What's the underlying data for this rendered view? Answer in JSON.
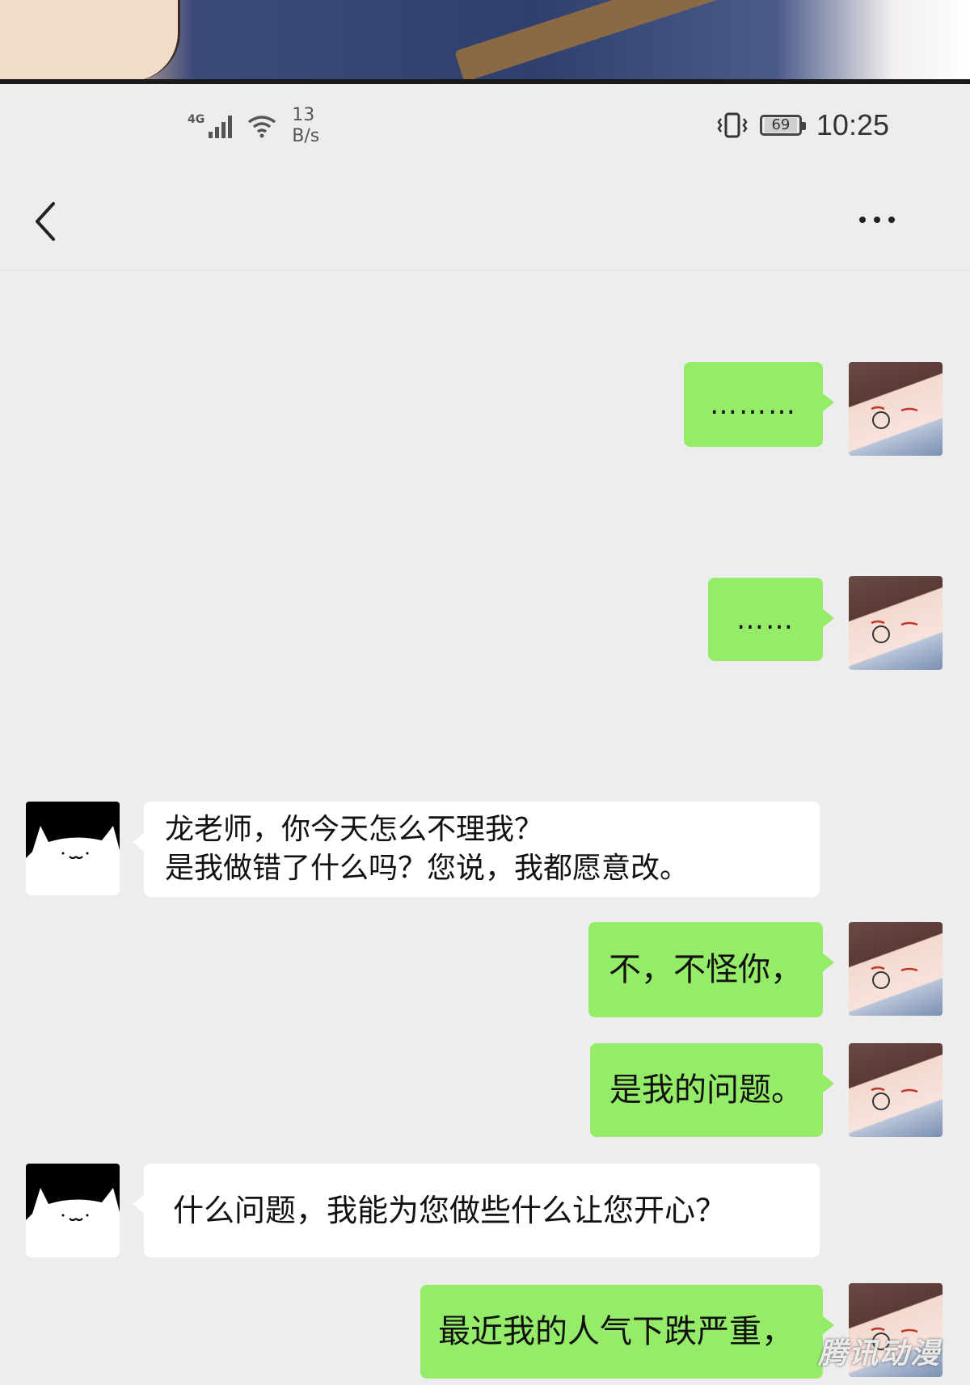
{
  "status_bar": {
    "network_label": "4G",
    "net_speed_value": "13",
    "net_speed_unit": "B/s",
    "battery_level": "69",
    "time": "10:25"
  },
  "icons": {
    "back": "chevron-left-icon",
    "more": "more-dots-icon",
    "wifi": "wifi-icon",
    "signal": "signal-icon",
    "vibrate": "vibrate-icon",
    "battery": "battery-icon"
  },
  "colors": {
    "chat_background": "#ededed",
    "outgoing_bubble": "#95ec69",
    "incoming_bubble": "#ffffff"
  },
  "messages": [
    {
      "sender": "me",
      "text": "………"
    },
    {
      "sender": "me",
      "text": "……"
    },
    {
      "sender": "them",
      "text": "龙老师，你今天怎么不理我？\n是我做错了什么吗？您说，我都愿意改。"
    },
    {
      "sender": "me",
      "text": "不，不怪你，"
    },
    {
      "sender": "me",
      "text": "是我的问题。"
    },
    {
      "sender": "them",
      "text": "什么问题，我能为您做些什么让您开心？"
    },
    {
      "sender": "me",
      "text": "最近我的人气下跌严重，"
    }
  ],
  "watermark": "腾讯动漫"
}
